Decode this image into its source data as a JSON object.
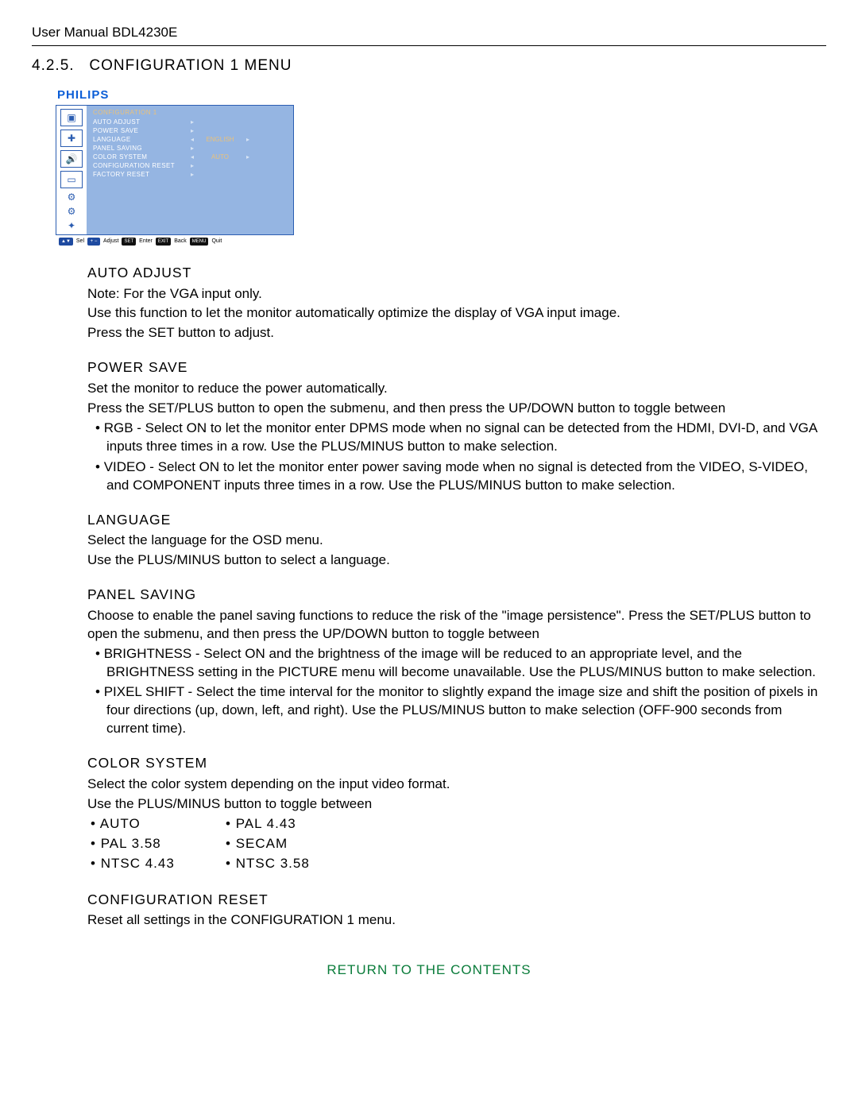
{
  "header": {
    "title": "User Manual BDL4230E"
  },
  "section": {
    "num": "4.2.5.",
    "title": "CONFIGURATION 1 MENU"
  },
  "osd": {
    "brand": "PHILIPS",
    "title": "CONFIGURATION 1",
    "items": [
      {
        "label": "AUTO ADJUST",
        "arrow": "▸",
        "val": "",
        "larrow": ""
      },
      {
        "label": "POWER SAVE",
        "arrow": "▸",
        "val": "",
        "larrow": ""
      },
      {
        "label": "LANGUAGE",
        "arrow": "▸",
        "val": "ENGLISH",
        "larrow": "◂"
      },
      {
        "label": "PANEL SAVING",
        "arrow": "▸",
        "val": "",
        "larrow": ""
      },
      {
        "label": "COLOR SYSTEM",
        "arrow": "▸",
        "val": "AUTO",
        "larrow": "◂"
      },
      {
        "label": "CONFIGURATION RESET",
        "arrow": "▸",
        "val": "",
        "larrow": ""
      },
      {
        "label": "FACTORY RESET",
        "arrow": "▸",
        "val": "",
        "larrow": ""
      }
    ],
    "legend": {
      "sel_pill": "▲▼",
      "sel": "Sel",
      "adj_pill": "+ −",
      "adj": "Adjust",
      "set_pill": "SET",
      "set": "Enter",
      "exit_pill": "EXIT",
      "exit": "Back",
      "menu_pill": "MENU",
      "menu": "Quit"
    }
  },
  "autoAdjust": {
    "h": "AUTO ADJUST",
    "note": "Note: For the VGA input only.",
    "p1": "Use this function to let the monitor automatically optimize the display of VGA input image.",
    "p2": "Press the SET button to adjust."
  },
  "powerSave": {
    "h": "POWER SAVE",
    "p1": "Set the monitor to reduce the power automatically.",
    "p2": "Press the SET/PLUS button to open the submenu, and then press the UP/DOWN button to toggle between",
    "b1": "RGB - Select ON to let the monitor enter DPMS mode when no signal can be detected from the HDMI, DVI-D, and VGA inputs three times in a row. Use the PLUS/MINUS button to make selection.",
    "b2": "VIDEO - Select ON to let the monitor enter power saving mode when no signal is detected from the VIDEO, S-VIDEO, and COMPONENT inputs three times in a row. Use the PLUS/MINUS button to make selection."
  },
  "language": {
    "h": "LANGUAGE",
    "p1": "Select the language for the OSD menu.",
    "p2": "Use the PLUS/MINUS button to select a language."
  },
  "panelSaving": {
    "h": "PANEL SAVING",
    "p1": "Choose to enable the panel saving functions to reduce the risk of the \"image persistence\". Press the SET/PLUS button to open the submenu, and then press the UP/DOWN button to toggle between",
    "b1": "BRIGHTNESS - Select ON and the brightness of the image will be reduced to an appropriate level, and the BRIGHTNESS setting in the PICTURE menu will become unavailable. Use the PLUS/MINUS button to make selection.",
    "b2": "PIXEL SHIFT - Select the time interval for the monitor to slightly expand the image size and shift the position of pixels in four directions (up, down, left, and right). Use the PLUS/MINUS button to make selection (OFF-900 seconds from current time)."
  },
  "colorSystem": {
    "h": "COLOR SYSTEM",
    "p1": "Select the color system depending on the input video format.",
    "p2": "Use the PLUS/MINUS button to toggle between",
    "col1": [
      "AUTO",
      "PAL 3.58",
      "NTSC 4.43"
    ],
    "col2": [
      "PAL 4.43",
      "SECAM",
      "NTSC 3.58"
    ]
  },
  "configReset": {
    "h": "CONFIGURATION RESET",
    "p1": "Reset all settings in the CONFIGURATION 1 menu."
  },
  "footer": {
    "link": "RETURN TO THE CONTENTS"
  }
}
